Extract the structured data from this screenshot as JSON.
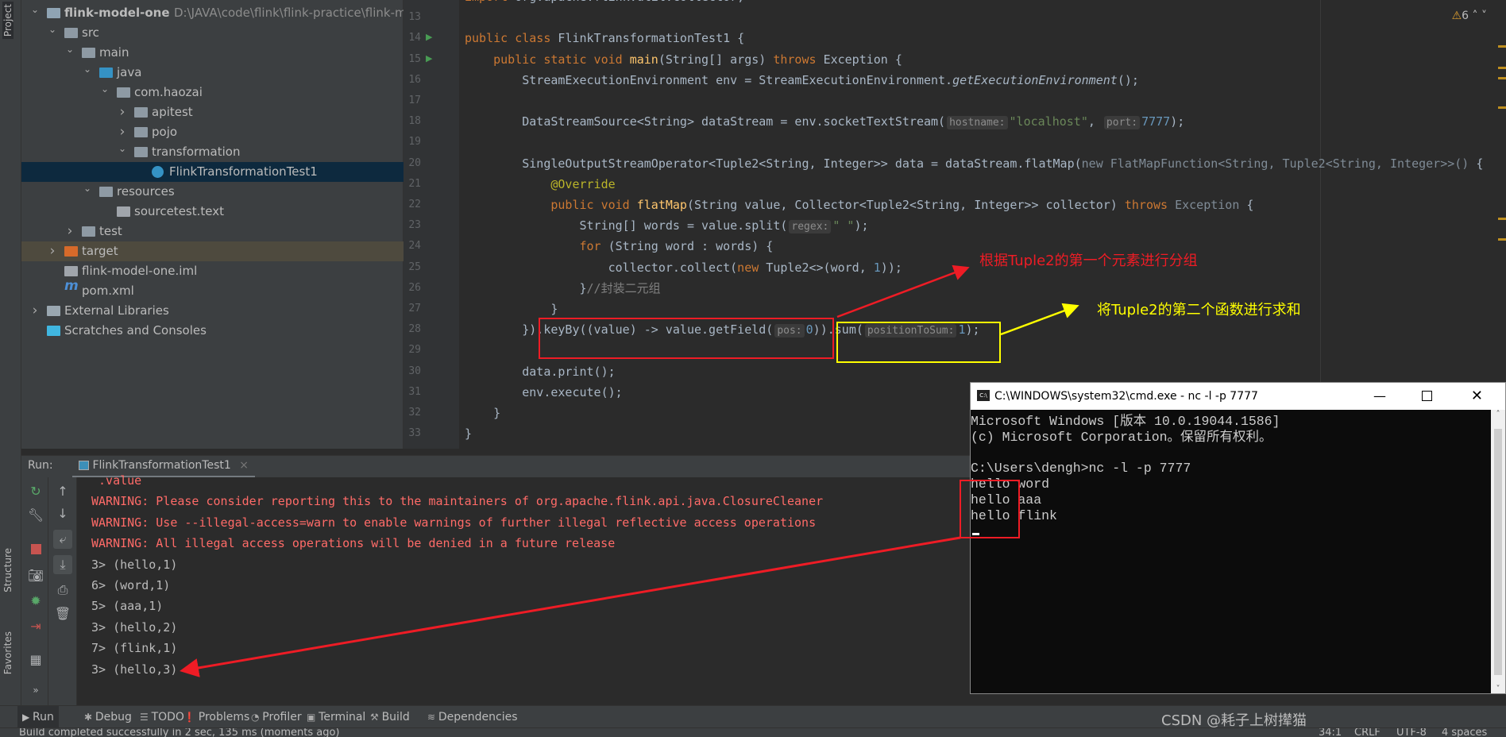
{
  "left_strip": {
    "project_tab": "Project",
    "structure_tab": "Structure",
    "favorites_tab": "Favorites"
  },
  "tree": [
    {
      "label": "flink-model-one",
      "path": "D:\\JAVA\\code\\flink\\flink-practice\\flink-m",
      "level": 0,
      "chev": "down",
      "icon": "module-folder-icon",
      "bold": true
    },
    {
      "label": "src",
      "level": 1,
      "chev": "down",
      "icon": "folder-icon"
    },
    {
      "label": "main",
      "level": 2,
      "chev": "down",
      "icon": "folder-icon"
    },
    {
      "label": "java",
      "level": 3,
      "chev": "down",
      "icon": "source-folder-icon"
    },
    {
      "label": "com.haozai",
      "level": 4,
      "chev": "down",
      "icon": "package-icon"
    },
    {
      "label": "apitest",
      "level": 5,
      "chev": "right",
      "icon": "package-icon"
    },
    {
      "label": "pojo",
      "level": 5,
      "chev": "right",
      "icon": "package-icon"
    },
    {
      "label": "transformation",
      "level": 5,
      "chev": "down",
      "icon": "package-icon"
    },
    {
      "label": "FlinkTransformationTest1",
      "level": 6,
      "chev": "",
      "icon": "java-class-icon",
      "selected": true
    },
    {
      "label": "resources",
      "level": 3,
      "chev": "down",
      "icon": "resources-folder-icon"
    },
    {
      "label": "sourcetest.text",
      "level": 4,
      "chev": "",
      "icon": "text-file-icon"
    },
    {
      "label": "test",
      "level": 2,
      "chev": "right",
      "icon": "folder-icon"
    },
    {
      "label": "target",
      "level": 1,
      "chev": "right",
      "icon": "excluded-folder-icon",
      "target": true
    },
    {
      "label": "flink-model-one.iml",
      "level": 1,
      "chev": "",
      "icon": "iml-file-icon"
    },
    {
      "label": "pom.xml",
      "level": 1,
      "chev": "",
      "icon": "maven-icon"
    },
    {
      "label": "External Libraries",
      "level": 0,
      "chev": "right",
      "icon": "libraries-icon"
    },
    {
      "label": "Scratches and Consoles",
      "level": 0,
      "chev": "",
      "icon": "scratches-icon"
    }
  ],
  "editor": {
    "warnings_count": "6",
    "lines": [
      {
        "no": "12",
        "t": [
          [
            "import",
            "k"
          ],
          [
            " org.apache.flink.util.Collector;",
            ""
          ]
        ]
      },
      {
        "no": "13",
        "t": []
      },
      {
        "no": "14",
        "run": true,
        "t": [
          [
            "public class ",
            "k"
          ],
          [
            "FlinkTransformationTest1 {",
            ""
          ]
        ]
      },
      {
        "no": "15",
        "run": true,
        "t": [
          [
            "    public static void ",
            "k"
          ],
          [
            "main",
            "m"
          ],
          [
            "(String[] args) ",
            ""
          ],
          [
            "throws ",
            "k"
          ],
          [
            "Exception {",
            ""
          ]
        ]
      },
      {
        "no": "16",
        "t": [
          [
            "        StreamExecutionEnvironment env = StreamExecutionEnvironment.",
            ""
          ],
          [
            "getExecutionEnvironment",
            "i"
          ],
          [
            "();",
            ""
          ]
        ]
      },
      {
        "no": "17",
        "t": []
      },
      {
        "no": "18",
        "t": [
          [
            "        DataStreamSource<String> dataStream = env.socketTextStream(",
            ""
          ],
          [
            "hostname:",
            "h"
          ],
          [
            "\"localhost\"",
            "s"
          ],
          [
            ", ",
            ""
          ],
          [
            "port:",
            "h"
          ],
          [
            "7777",
            "n"
          ],
          [
            ");",
            ""
          ]
        ]
      },
      {
        "no": "19",
        "t": []
      },
      {
        "no": "20",
        "t": [
          [
            "        SingleOutputStreamOperator<Tuple2<String, Integer>> data = dataStream.flatMap(",
            ""
          ],
          [
            "new FlatMapFunction<String, Tuple2<String, Integer>>()",
            "g"
          ],
          [
            " {",
            ""
          ]
        ]
      },
      {
        "no": "21",
        "t": [
          [
            "            @Override",
            "a"
          ]
        ]
      },
      {
        "no": "22",
        "t": [
          [
            "            public void ",
            "k"
          ],
          [
            "flatMap",
            "m"
          ],
          [
            "(String value, Collector<Tuple2<String, Integer>> collector) ",
            ""
          ],
          [
            "throws ",
            "k"
          ],
          [
            "Exception",
            "g"
          ],
          [
            " {",
            ""
          ]
        ]
      },
      {
        "no": "23",
        "t": [
          [
            "                String[] words = value.split(",
            ""
          ],
          [
            "regex:",
            "h"
          ],
          [
            "\" \"",
            "s"
          ],
          [
            ");",
            ""
          ]
        ]
      },
      {
        "no": "24",
        "t": [
          [
            "                for ",
            "k"
          ],
          [
            "(String word : words) {",
            ""
          ]
        ]
      },
      {
        "no": "25",
        "t": [
          [
            "                    collector.collect(",
            ""
          ],
          [
            "new ",
            "k"
          ],
          [
            "Tuple2<>(word, ",
            ""
          ],
          [
            "1",
            "n"
          ],
          [
            "));",
            ""
          ]
        ]
      },
      {
        "no": "26",
        "t": [
          [
            "                }",
            ""
          ],
          [
            "//封装二元组",
            "c"
          ]
        ]
      },
      {
        "no": "27",
        "t": [
          [
            "            }",
            ""
          ]
        ]
      },
      {
        "no": "28",
        "t": [
          [
            "        }).keyBy((value) -> value.getField(",
            ""
          ],
          [
            "pos:",
            "h"
          ],
          [
            "0",
            "n"
          ],
          [
            ")).sum(",
            ""
          ],
          [
            "positionToSum:",
            "h"
          ],
          [
            "1",
            "n"
          ],
          [
            ");",
            ""
          ]
        ]
      },
      {
        "no": "29",
        "t": []
      },
      {
        "no": "30",
        "t": [
          [
            "        data.print();",
            ""
          ]
        ]
      },
      {
        "no": "31",
        "t": [
          [
            "        env.execute();",
            ""
          ]
        ]
      },
      {
        "no": "32",
        "t": [
          [
            "    }",
            ""
          ]
        ]
      },
      {
        "no": "33",
        "t": [
          [
            "}",
            ""
          ]
        ]
      }
    ]
  },
  "annotations": {
    "group_note": "根据Tuple2的第一个元素进行分组",
    "sum_note": "将Tuple2的第二个函数进行求和",
    "colors": {
      "red": "#ee1c25",
      "yellow": "#ffff00"
    }
  },
  "run": {
    "label": "Run:",
    "tab": "FlinkTransformationTest1",
    "lines": [
      {
        "text": " .value",
        "warn": true
      },
      {
        "text": "WARNING: Please consider reporting this to the maintainers of org.apache.flink.api.java.ClosureCleaner",
        "warn": true
      },
      {
        "text": "WARNING: Use --illegal-access=warn to enable warnings of further illegal reflective access operations",
        "warn": true
      },
      {
        "text": "WARNING: All illegal access operations will be denied in a future release",
        "warn": true
      },
      {
        "text": "3> (hello,1)"
      },
      {
        "text": "6> (word,1)"
      },
      {
        "text": "5> (aaa,1)"
      },
      {
        "text": "3> (hello,2)"
      },
      {
        "text": "7> (flink,1)"
      },
      {
        "text": "3> (hello,3)"
      }
    ]
  },
  "cmd": {
    "title": "C:\\WINDOWS\\system32\\cmd.exe - nc  -l -p 7777",
    "icon_text": "C:\\",
    "lines": [
      "Microsoft Windows [版本 10.0.19044.1586]",
      "(c) Microsoft Corporation。保留所有权利。",
      "",
      "C:\\Users\\dengh>nc -l -p 7777",
      "hello word",
      "hello aaa",
      "hello flink"
    ]
  },
  "bottom_tabs": [
    "Run",
    "Debug",
    "TODO",
    "Problems",
    "Profiler",
    "Terminal",
    "Build",
    "Dependencies"
  ],
  "status": {
    "message": "Build completed successfully in 2 sec, 135 ms (moments ago)",
    "position": "34:1",
    "line_sep": "CRLF",
    "encoding": "UTF-8",
    "indent": "4 spaces"
  },
  "watermark": "CSDN @耗子上树撵猫"
}
